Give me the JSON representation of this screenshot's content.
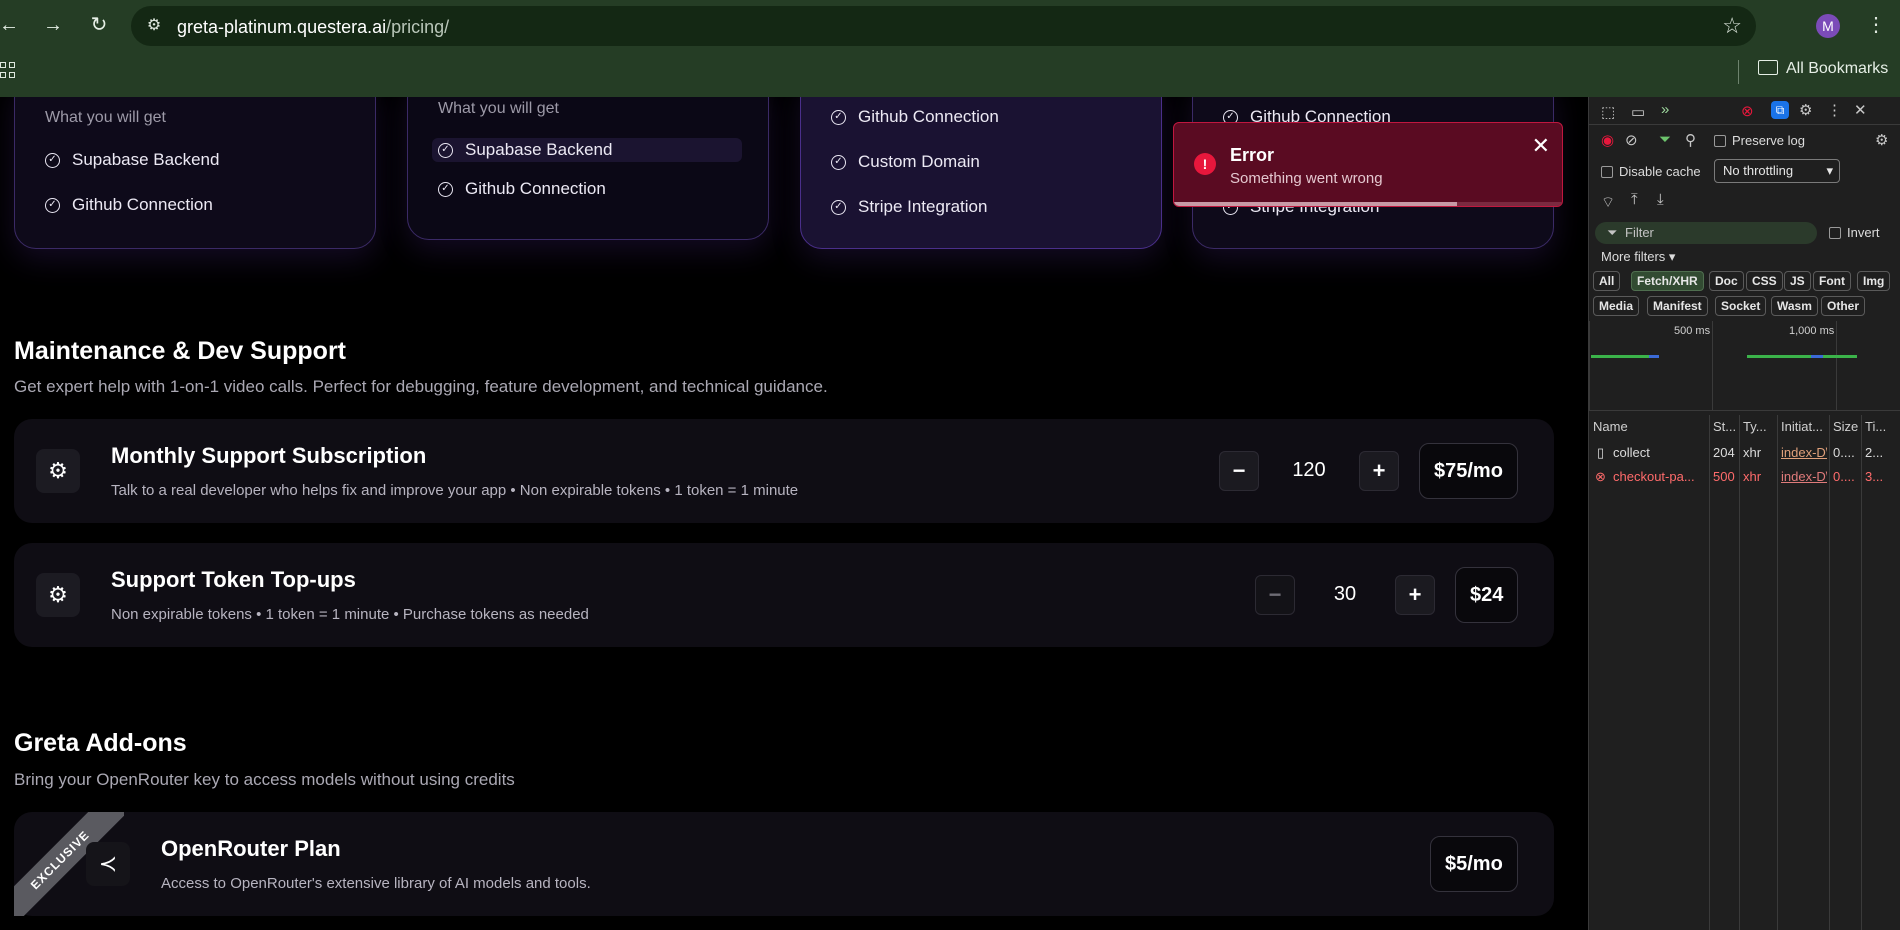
{
  "browser": {
    "url_host": "greta-platinum.questera.ai",
    "url_path": "/pricing/",
    "avatar_letter": "M",
    "all_bookmarks": "All Bookmarks",
    "nav_back": "←",
    "nav_forward": "→",
    "nav_reload": "↻"
  },
  "plans": [
    {
      "heading": "What you will get",
      "features": [
        "Supabase Backend",
        "Github Connection"
      ]
    },
    {
      "heading": "What you will get",
      "features": [
        "Supabase Backend",
        "Github Connection"
      ]
    },
    {
      "heading": "",
      "features": [
        "Github Connection",
        "Custom Domain",
        "Stripe Integration"
      ]
    },
    {
      "heading": "",
      "features": [
        "Github Connection",
        "Stripe Integration"
      ]
    }
  ],
  "maintenance": {
    "title": "Maintenance & Dev Support",
    "subtitle": "Get expert help with 1-on-1 video calls. Perfect for debugging, feature development, and technical guidance.",
    "rows": [
      {
        "title": "Monthly Support Subscription",
        "desc": "Talk to a real developer who helps fix and improve your app • Non expirable tokens • 1 token = 1 minute",
        "qty": "120",
        "price": "$75/mo",
        "minus": "−",
        "plus": "+"
      },
      {
        "title": "Support Token Top-ups",
        "desc": "Non expirable tokens • 1 token = 1 minute • Purchase tokens as needed",
        "qty": "30",
        "price": "$24",
        "minus": "−",
        "plus": "+"
      }
    ]
  },
  "addons": {
    "title": "Greta Add-ons",
    "subtitle": "Bring your OpenRouter key to access models without using credits",
    "row": {
      "ribbon": "EXCLUSIVE",
      "title": "OpenRouter Plan",
      "desc": "Access to OpenRouter's extensive library of AI models and tools.",
      "price": "$5/mo"
    }
  },
  "toast": {
    "title": "Error",
    "message": "Something went wrong",
    "close": "✕",
    "progress": 0.73
  },
  "devtools": {
    "preserve_log": "Preserve log",
    "disable_cache": "Disable cache",
    "throttling": "No throttling",
    "filter_placeholder": "Filter",
    "invert": "Invert",
    "more_filters": "More filters",
    "type_filters": [
      "All",
      "Fetch/XHR",
      "Doc",
      "CSS",
      "JS",
      "Font",
      "Img"
    ],
    "type_filters_row2": [
      "Media",
      "Manifest",
      "Socket",
      "Wasm",
      "Other"
    ],
    "active_filter": "Fetch/XHR",
    "timeline_labels": [
      "500 ms",
      "1,000 ms"
    ],
    "columns": [
      "Name",
      "St...",
      "Ty...",
      "Initiat...",
      "Size",
      "Ti..."
    ],
    "requests": [
      {
        "name": "collect",
        "status": "204",
        "type": "xhr",
        "initiator": "index-D\\",
        "size": "0....",
        "time": "2...",
        "error": false
      },
      {
        "name": "checkout-pa...",
        "status": "500",
        "type": "xhr",
        "initiator": "index-D\\",
        "size": "0....",
        "time": "3...",
        "error": true
      }
    ]
  },
  "colors": {
    "toast_bg": "#5a0b22",
    "toast_border": "#c0173f",
    "chrome_green": "#253d25",
    "accent_purple": "#3b2a66"
  }
}
